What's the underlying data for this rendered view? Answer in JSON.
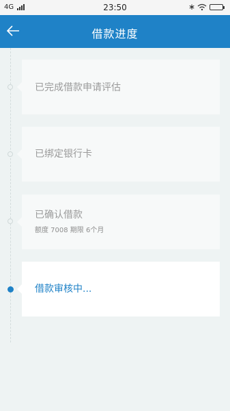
{
  "status_bar": {
    "network": "4G",
    "time": "23:50",
    "bluetooth_icon": "bluetooth-icon",
    "wifi_icon": "wifi-icon",
    "battery_icon": "battery-icon"
  },
  "nav": {
    "back_icon": "back-arrow-icon",
    "title": "借款进度",
    "color": "#1f82c7"
  },
  "steps": [
    {
      "title": "已完成借款申请评估",
      "status": "done"
    },
    {
      "title": "已绑定银行卡",
      "status": "done"
    },
    {
      "title": "已确认借款",
      "detail": "额度 7008 期限  6个月",
      "status": "done"
    },
    {
      "title": "借款审核中...",
      "status": "active"
    }
  ]
}
